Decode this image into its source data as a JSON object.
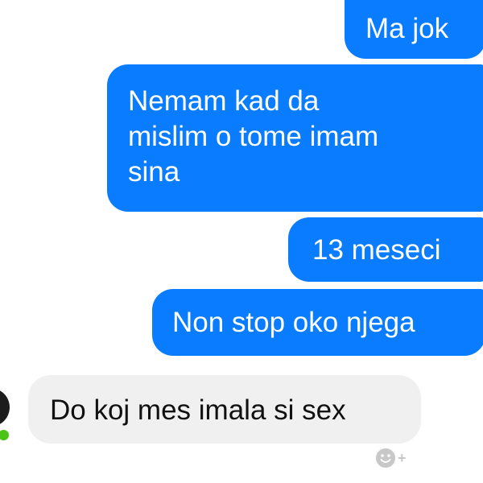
{
  "chat": {
    "messages": [
      {
        "direction": "outgoing",
        "text": "Ma jok"
      },
      {
        "direction": "outgoing",
        "text": "Nemam kad da\nmislim o tome imam\nsina"
      },
      {
        "direction": "outgoing",
        "text": "13 meseci"
      },
      {
        "direction": "outgoing",
        "text": "Non stop oko njega"
      },
      {
        "direction": "incoming",
        "text": "Do koj mes imala si sex"
      }
    ],
    "reaction_button": {
      "icon": "smiley-add-icon",
      "plus": "+"
    }
  },
  "colors": {
    "outgoing_bubble": "#0a7cff",
    "incoming_bubble": "#f0f0f0",
    "online_indicator": "#4cc417"
  }
}
